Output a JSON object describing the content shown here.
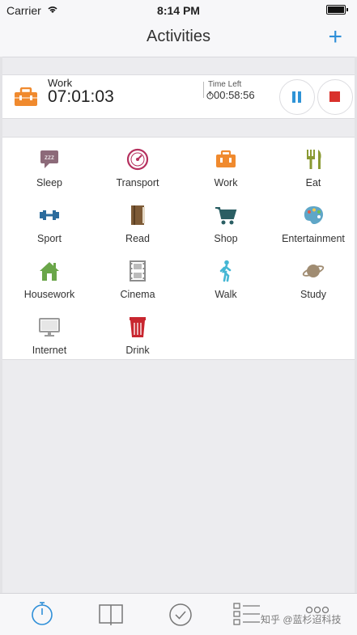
{
  "status_bar": {
    "carrier": "Carrier",
    "time": "8:14 PM"
  },
  "nav": {
    "title": "Activities",
    "add_label": "+"
  },
  "current": {
    "activity": "Work",
    "elapsed": "07:01:03",
    "time_left_label": "Time Left",
    "time_left": "00:58:56"
  },
  "activities": [
    {
      "label": "Sleep",
      "icon": "sleep-bubble-icon",
      "color": "#8c6a79"
    },
    {
      "label": "Transport",
      "icon": "speedometer-icon",
      "color": "#b5305e"
    },
    {
      "label": "Work",
      "icon": "briefcase-icon",
      "color": "#f08a2e"
    },
    {
      "label": "Eat",
      "icon": "fork-knife-icon",
      "color": "#8a9a33"
    },
    {
      "label": "Sport",
      "icon": "dumbbell-icon",
      "color": "#2c6c9d"
    },
    {
      "label": "Read",
      "icon": "book-icon",
      "color": "#7d5a36"
    },
    {
      "label": "Shop",
      "icon": "shopping-cart-icon",
      "color": "#2a5e63"
    },
    {
      "label": "Entertainment",
      "icon": "palette-icon",
      "color": "#5fa6c7"
    },
    {
      "label": "Housework",
      "icon": "house-icon",
      "color": "#6aa649"
    },
    {
      "label": "Cinema",
      "icon": "film-icon",
      "color": "#8d8d8d"
    },
    {
      "label": "Walk",
      "icon": "walking-person-icon",
      "color": "#45b7d4"
    },
    {
      "label": "Study",
      "icon": "planet-icon",
      "color": "#a08c72"
    },
    {
      "label": "Internet",
      "icon": "monitor-icon",
      "color": "#9a9a9a"
    },
    {
      "label": "Drink",
      "icon": "cup-icon",
      "color": "#c8262f"
    }
  ],
  "tabbar": {
    "tabs": [
      {
        "icon": "stopwatch-icon",
        "active": true
      },
      {
        "icon": "book-open-icon"
      },
      {
        "icon": "check-circle-icon"
      },
      {
        "icon": "list-icon"
      },
      {
        "icon": "more-icon"
      }
    ],
    "accent": "#2f8fd8"
  },
  "watermark": "知乎 @蓝杉迢科技"
}
